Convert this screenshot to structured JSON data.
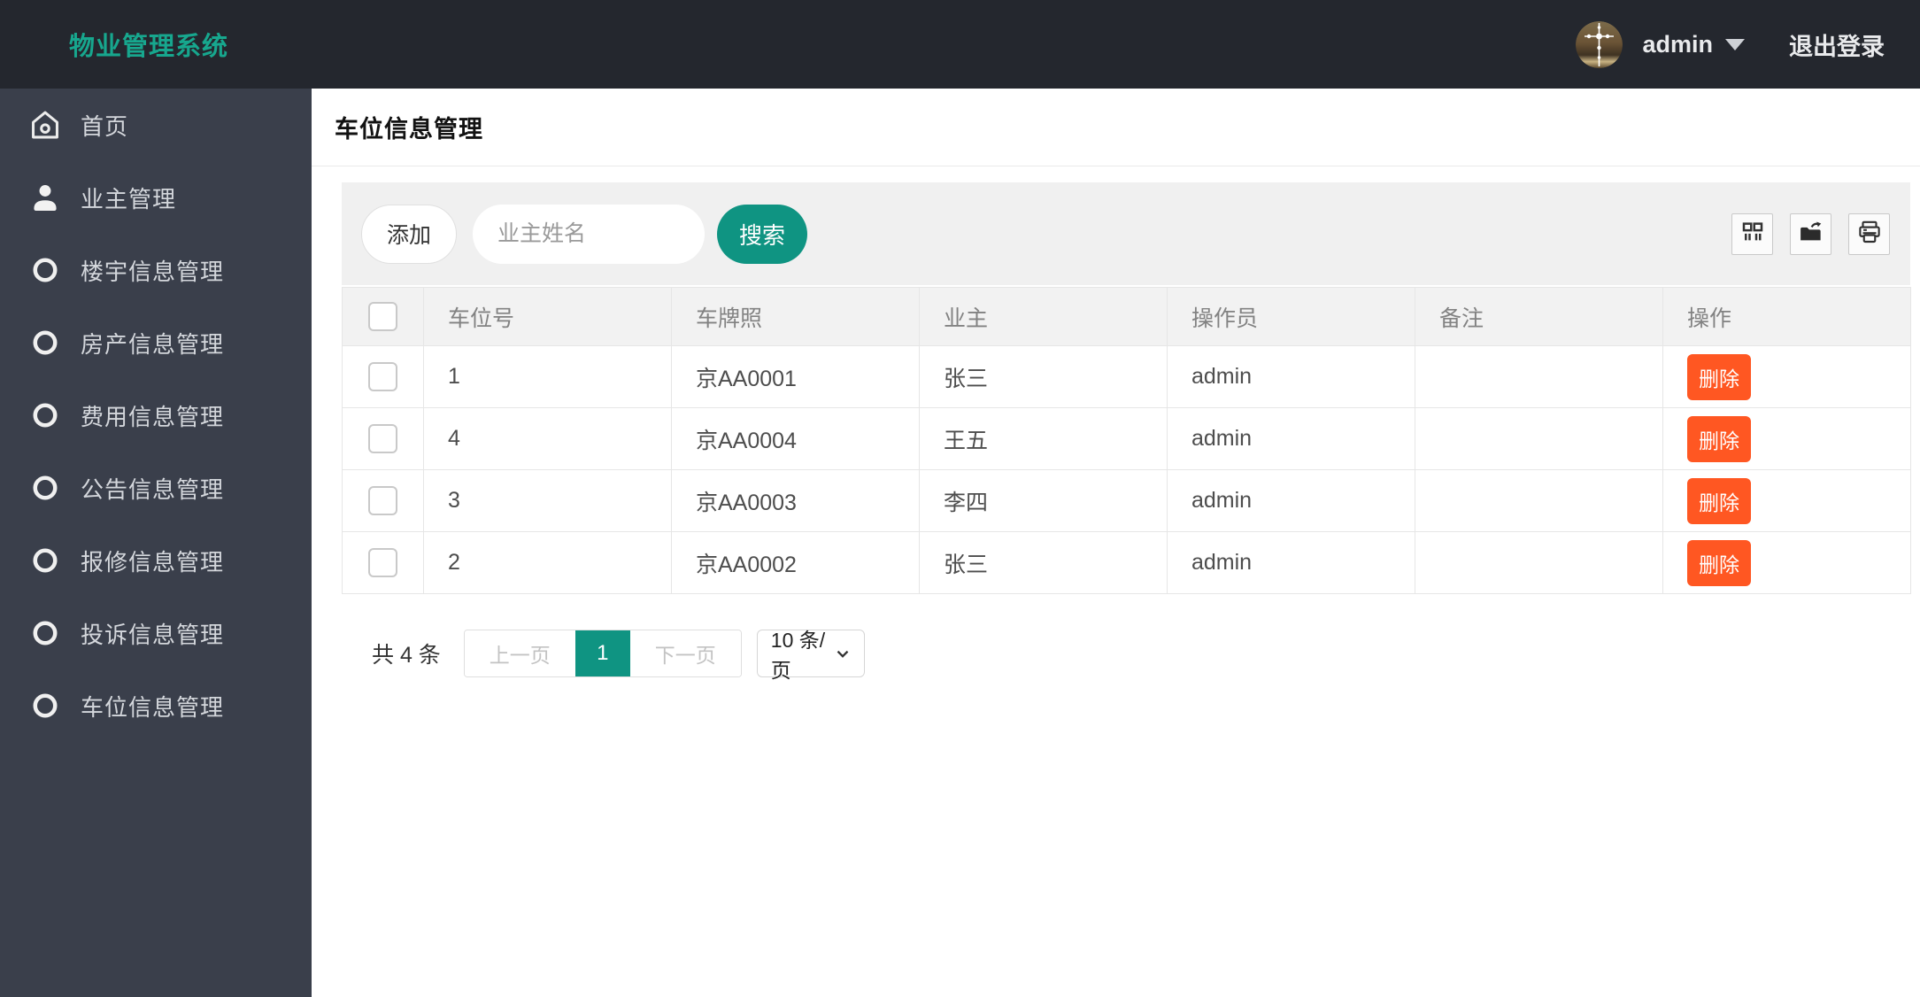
{
  "topbar": {
    "brand": "物业管理系统",
    "username": "admin",
    "logout_label": "退出登录"
  },
  "sidebar": {
    "items": [
      {
        "label": "首页",
        "icon": "home-icon"
      },
      {
        "label": "业主管理",
        "icon": "user-icon"
      },
      {
        "label": "楼宇信息管理",
        "icon": "circle-icon"
      },
      {
        "label": "房产信息管理",
        "icon": "circle-icon"
      },
      {
        "label": "费用信息管理",
        "icon": "circle-icon"
      },
      {
        "label": "公告信息管理",
        "icon": "circle-icon"
      },
      {
        "label": "报修信息管理",
        "icon": "circle-icon"
      },
      {
        "label": "投诉信息管理",
        "icon": "circle-icon"
      },
      {
        "label": "车位信息管理",
        "icon": "circle-icon"
      }
    ]
  },
  "page": {
    "title": "车位信息管理"
  },
  "toolbar": {
    "add_label": "添加",
    "search_placeholder": "业主姓名",
    "search_label": "搜索",
    "icon_buttons": [
      {
        "name": "columns-icon"
      },
      {
        "name": "export-icon"
      },
      {
        "name": "print-icon"
      }
    ]
  },
  "table": {
    "headers": [
      "车位号",
      "车牌照",
      "业主",
      "操作员",
      "备注",
      "操作"
    ],
    "rows": [
      {
        "cells": [
          "1",
          "京AA0001",
          "张三",
          "admin",
          ""
        ],
        "action": "删除"
      },
      {
        "cells": [
          "4",
          "京AA0004",
          "王五",
          "admin",
          ""
        ],
        "action": "删除"
      },
      {
        "cells": [
          "3",
          "京AA0003",
          "李四",
          "admin",
          ""
        ],
        "action": "删除"
      },
      {
        "cells": [
          "2",
          "京AA0002",
          "张三",
          "admin",
          ""
        ],
        "action": "删除"
      }
    ]
  },
  "pagination": {
    "total_text": "共 4 条",
    "prev_label": "上一页",
    "current_page": "1",
    "next_label": "下一页",
    "page_size": "10 条/页"
  },
  "colors": {
    "brand_teal": "#17a78e",
    "button_teal": "#0f9482",
    "delete_orange": "#ff5722",
    "topbar_bg": "#24272e",
    "sidebar_bg": "#3a3f4b"
  }
}
